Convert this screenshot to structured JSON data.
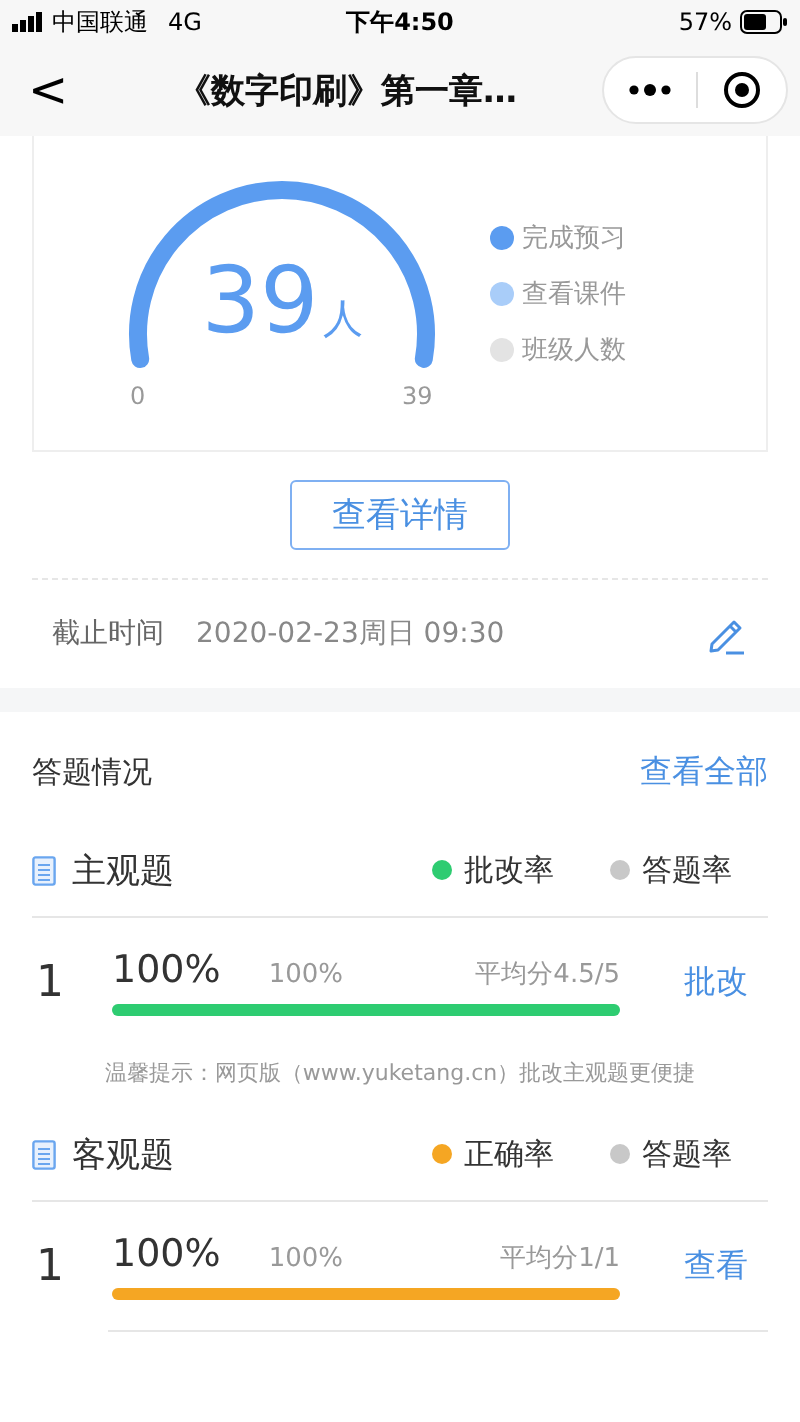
{
  "status_bar": {
    "carrier": "中国联通",
    "network": "4G",
    "time": "下午4:50",
    "battery": "57%"
  },
  "nav": {
    "back": "<",
    "title": "《数字印刷》第一章…"
  },
  "gauge": {
    "value": "39",
    "unit": "人",
    "min": "0",
    "max": "39",
    "legend": [
      {
        "label": "完成预习",
        "color": "#5b9cf0"
      },
      {
        "label": "查看课件",
        "color": "#a9cdf9"
      },
      {
        "label": "班级人数",
        "color": "#e3e3e3"
      }
    ]
  },
  "details_button": "查看详情",
  "deadline": {
    "label": "截止时间",
    "value": "2020-02-23周日 09:30"
  },
  "answers": {
    "title": "答题情况",
    "view_all": "查看全部",
    "groups": [
      {
        "title": "主观题",
        "legend": [
          {
            "label": "批改率",
            "color": "#2ecc71"
          },
          {
            "label": "答题率",
            "color": "#c8c8c8"
          }
        ],
        "rows": [
          {
            "index": "1",
            "rate": "100%",
            "answer_rate": "100%",
            "average": "平均分4.5/5",
            "action": "批改",
            "level": 1,
            "color": "#2ecc71"
          }
        ],
        "tip": "温馨提示：网页版（www.yuketang.cn）批改主观题更便捷"
      },
      {
        "title": "客观题",
        "legend": [
          {
            "label": "正确率",
            "color": "#f5a623"
          },
          {
            "label": "答题率",
            "color": "#c8c8c8"
          }
        ],
        "rows": [
          {
            "index": "1",
            "rate": "100%",
            "answer_rate": "100%",
            "average": "平均分1/1",
            "action": "查看",
            "level": 1,
            "color": "#f5a623"
          }
        ]
      }
    ]
  }
}
